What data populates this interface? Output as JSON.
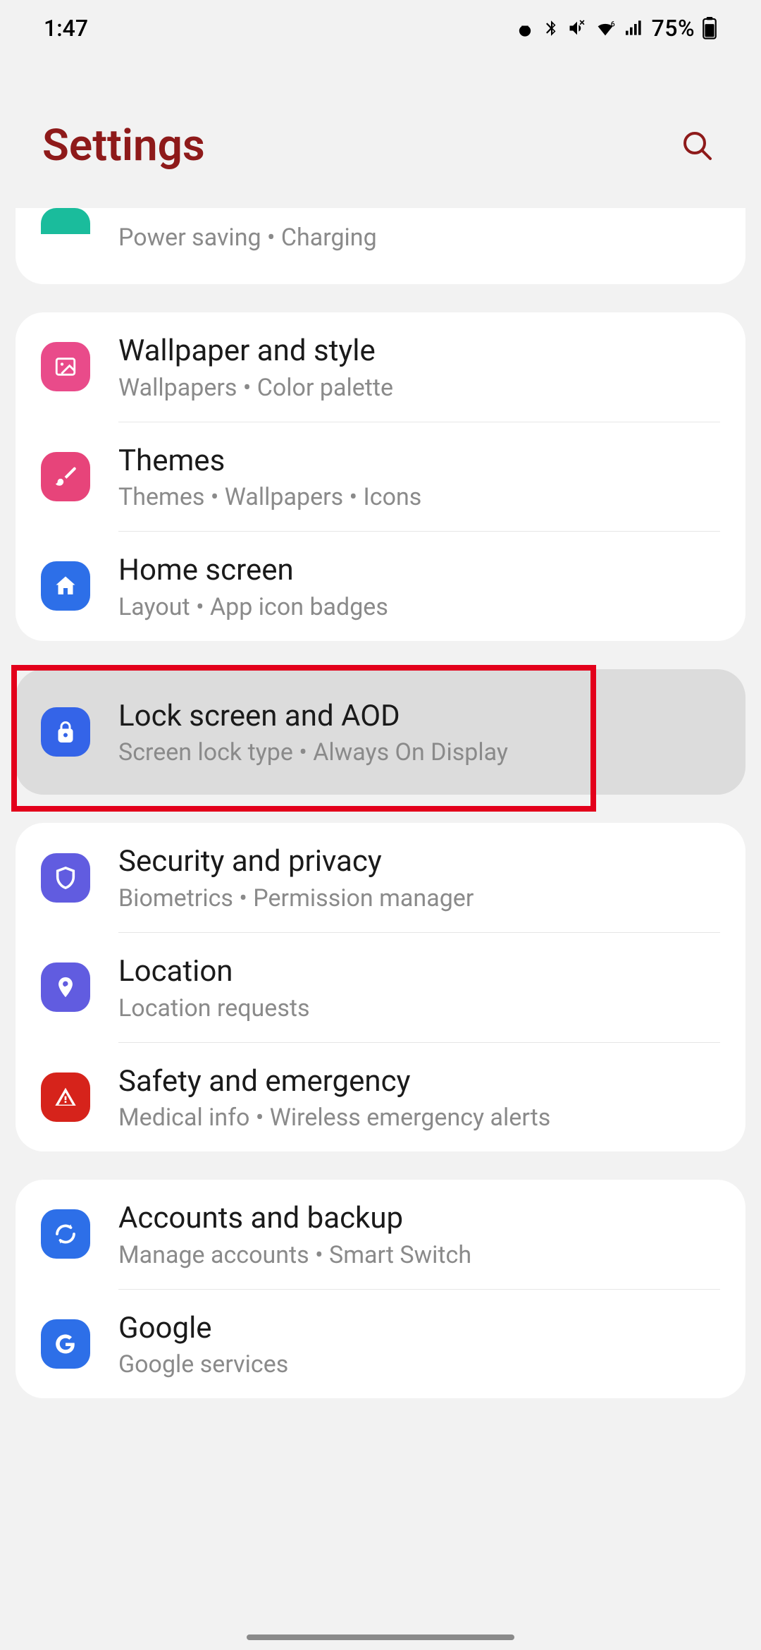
{
  "status": {
    "time": "1:47",
    "battery": "75%"
  },
  "header": {
    "title": "Settings"
  },
  "partial": {
    "sub": "Power saving  •  Charging"
  },
  "group1": [
    {
      "title": "Wallpaper and style",
      "sub": "Wallpapers  •  Color palette",
      "color": "c-pink",
      "icon": "image"
    },
    {
      "title": "Themes",
      "sub": "Themes  •  Wallpapers  •  Icons",
      "color": "c-pink2",
      "icon": "brush"
    },
    {
      "title": "Home screen",
      "sub": "Layout  •  App icon badges",
      "color": "c-blue",
      "icon": "home"
    }
  ],
  "highlight": {
    "title": "Lock screen and AOD",
    "sub": "Screen lock type  •  Always On Display",
    "color": "c-blue2",
    "icon": "lock"
  },
  "group2": [
    {
      "title": "Security and privacy",
      "sub": "Biometrics  •  Permission manager",
      "color": "c-indigo",
      "icon": "shield"
    },
    {
      "title": "Location",
      "sub": "Location requests",
      "color": "c-indigo",
      "icon": "pin"
    },
    {
      "title": "Safety and emergency",
      "sub": "Medical info  •  Wireless emergency alerts",
      "color": "c-red",
      "icon": "alert"
    }
  ],
  "group3": [
    {
      "title": "Accounts and backup",
      "sub": "Manage accounts  •  Smart Switch",
      "color": "c-blue3",
      "icon": "sync"
    },
    {
      "title": "Google",
      "sub": "Google services",
      "color": "c-blue3",
      "icon": "google"
    }
  ]
}
